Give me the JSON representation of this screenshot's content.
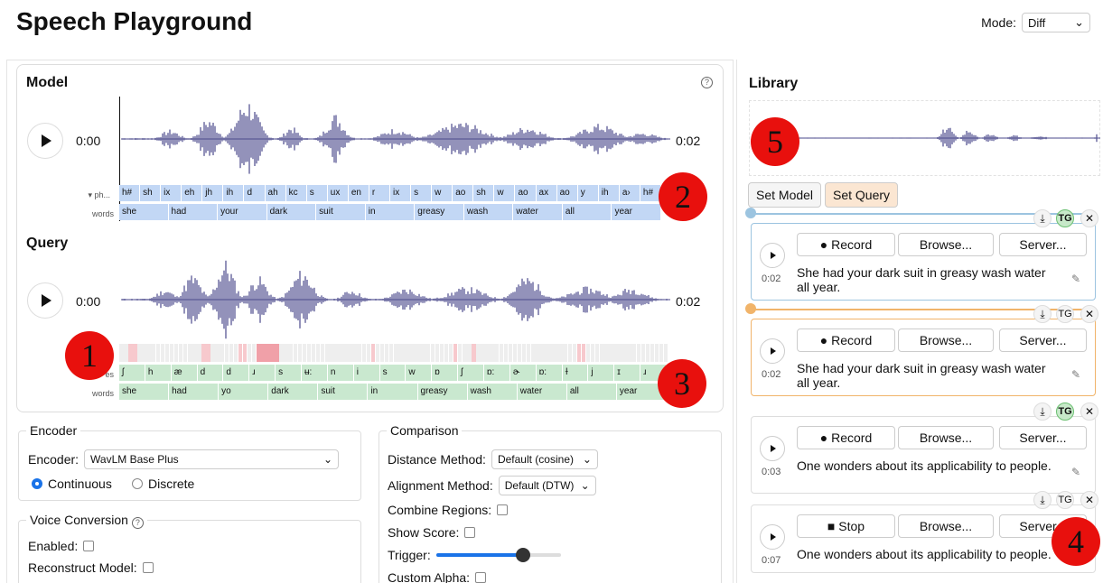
{
  "app": {
    "title": "Speech Playground"
  },
  "mode": {
    "label": "Mode:",
    "value": "Diff"
  },
  "model": {
    "title": "Model",
    "help": "?",
    "time": "0:00",
    "end_time": "0:02",
    "phones_label": "ph...",
    "words_label": "words",
    "phones": [
      "h#",
      "sh",
      "ix",
      "eh",
      "jh",
      "ih",
      "d",
      "ah",
      "kc",
      "s",
      "ux",
      "en",
      "r",
      "ix",
      "s",
      "w",
      "ao",
      "sh",
      "w",
      "ao",
      "ax",
      "ao",
      "y",
      "ih",
      "a›",
      "h#"
    ],
    "words": [
      "she",
      "had",
      "your",
      "dark",
      "suit",
      "in",
      "greasy",
      "wash",
      "water",
      "all",
      "year"
    ]
  },
  "query": {
    "title": "Query",
    "time": "0:00",
    "end_time": "0:02",
    "phones_label": "es",
    "words_label": "words",
    "phones": [
      "ʃ",
      "h",
      "æ",
      "d",
      "d",
      "ɹ",
      "s",
      "ʉ:",
      "n",
      "i",
      "s",
      "w",
      "ɒ",
      "ʃ",
      "ɒ:",
      "ɚ",
      "ɒ:",
      "ɫ",
      "j",
      "ɪ",
      "ɹ"
    ],
    "words": [
      "she",
      "had",
      "yo",
      "dark",
      "suit",
      "in",
      "greasy",
      "wash",
      "water",
      "all",
      "year"
    ]
  },
  "annotations": [
    "1",
    "2",
    "3",
    "4",
    "5"
  ],
  "encoder": {
    "legend": "Encoder",
    "label": "Encoder:",
    "value": "WavLM Base Plus",
    "opt_continuous": "Continuous",
    "opt_discrete": "Discrete"
  },
  "voice_conversion": {
    "legend": "Voice Conversion",
    "help": "?",
    "enabled": "Enabled:",
    "reconstruct": "Reconstruct Model:"
  },
  "comparison": {
    "legend": "Comparison",
    "distance_label": "Distance Method:",
    "distance_value": "Default (cosine)",
    "alignment_label": "Alignment Method:",
    "alignment_value": "Default (DTW)",
    "combine": "Combine Regions:",
    "show_score": "Show Score:",
    "trigger": "Trigger:",
    "trigger_level": 0.7,
    "custom_alpha": "Custom Alpha:"
  },
  "library": {
    "title": "Library",
    "set_model": "Set Model",
    "set_query": "Set Query",
    "cards": [
      {
        "time": "0:02",
        "record": "Record",
        "browse": "Browse...",
        "server": "Server...",
        "text": "She had your dark suit in greasy wash water all year."
      },
      {
        "time": "0:02",
        "record": "Record",
        "browse": "Browse...",
        "server": "Server...",
        "text": "She had your dark suit in greasy wash water all year."
      },
      {
        "time": "0:03",
        "record": "Record",
        "browse": "Browse...",
        "server": "Server...",
        "text": "One wonders about its applicability to people."
      },
      {
        "time": "0:07",
        "record": "Stop",
        "browse": "Browse...",
        "server": "Server...",
        "text": "One wonders about its applicability to people."
      }
    ],
    "tool_download": "⤓",
    "tool_tg": "TG",
    "tool_close": "✕"
  },
  "colors": {
    "wave": "#4b4a8c",
    "model_tier": "#c2d7f5",
    "query_tier": "#c9e8cf",
    "accent": "#1a73e8",
    "annotation": "#e8100d"
  }
}
